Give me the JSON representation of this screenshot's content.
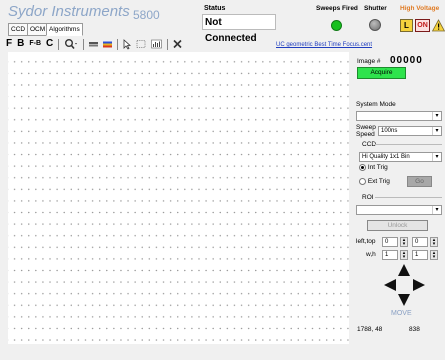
{
  "brand": {
    "name": "Sydor Instruments",
    "model": "5800"
  },
  "tabs": [
    {
      "label": "CCD"
    },
    {
      "label": "OCM"
    },
    {
      "label": "Algorithms"
    }
  ],
  "toolbar": {
    "f_label": "F",
    "b_label": "B",
    "fb_label": "F-B",
    "c_label": "C",
    "icons": [
      "zoom-icon",
      "color-bar-icon",
      "palette-icon",
      "pointer-icon",
      "select-box-icon",
      "histogram-icon",
      "cross-icon"
    ]
  },
  "status": {
    "label": "Status",
    "value": "Not Connected"
  },
  "sweeps_fired": {
    "label": "Sweeps Fired",
    "color": "#18c01f"
  },
  "shutter": {
    "label": "Shutter",
    "color": "#8a8a8a"
  },
  "high_voltage": {
    "label": "High Voltage",
    "l_label": "L",
    "on_label": "ON"
  },
  "link": "UC geometric Best Time Focus.cent",
  "image": {
    "label": "Image #",
    "number": "00000",
    "acquire_label": "Acquire"
  },
  "system_mode": {
    "label": "System Mode",
    "value": ""
  },
  "sweep_speed": {
    "label_line1": "Sweep",
    "label_line2": "Speed",
    "value": "100ns"
  },
  "ccd": {
    "label": "CCD",
    "quality": "Hi Quality 1x1 Bin",
    "int_trig": "Int Trig",
    "ext_trig": "Ext Trig",
    "go_label": "Go"
  },
  "roi": {
    "label": "ROI",
    "value": "",
    "unlock_label": "Unlock",
    "lefttop_label": "left,top",
    "left": "0",
    "top": "0",
    "wh_label": "w,h",
    "w": "1",
    "h": "1",
    "move_label": "MOVE"
  },
  "readout": {
    "coords": "1788, 48",
    "value": "838"
  }
}
